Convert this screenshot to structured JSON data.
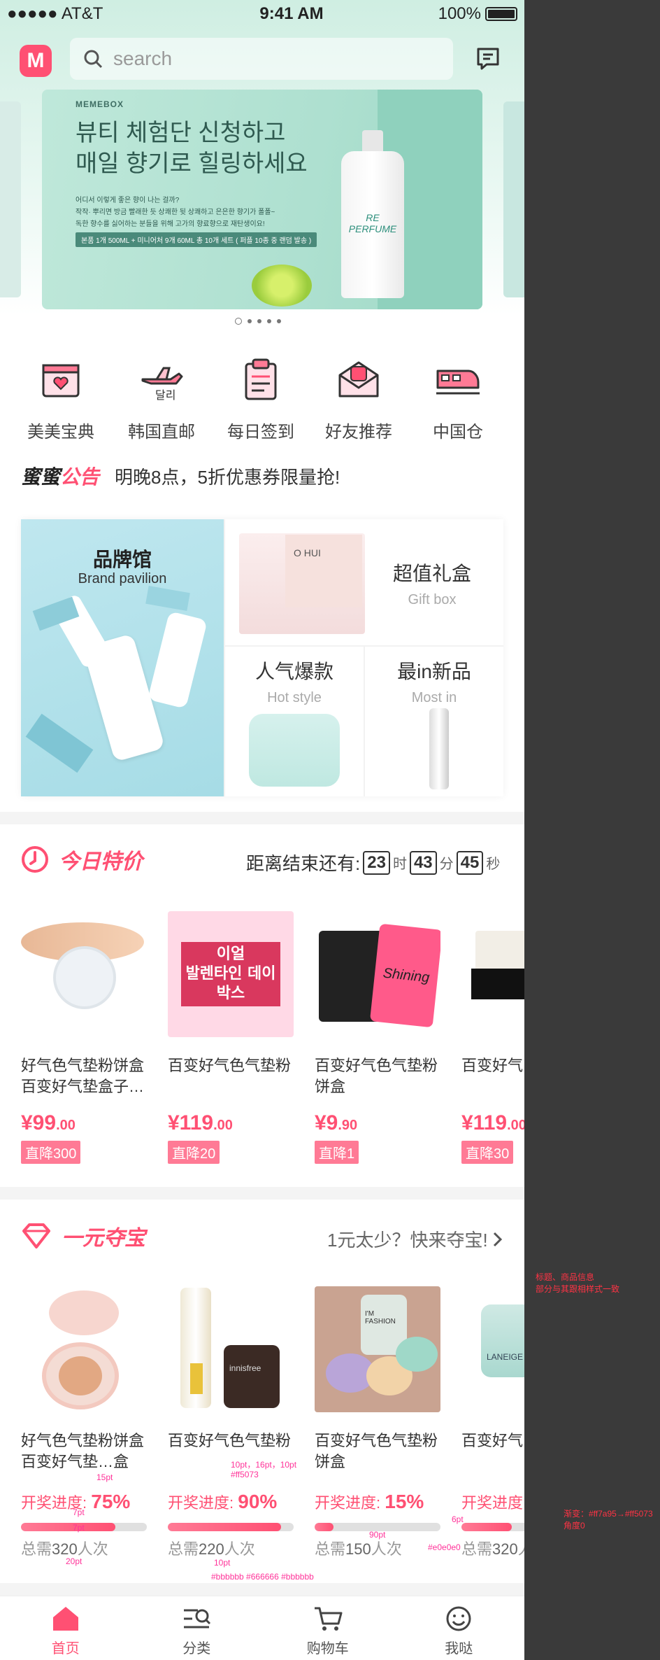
{
  "status_bar": {
    "carrier": "●●●●● AT&T",
    "time": "9:41 AM",
    "battery": "100%"
  },
  "header": {
    "logo": "M",
    "search_placeholder": "search"
  },
  "banner": {
    "brand": "MEMEBOX",
    "headline": "뷰티 체험단 신청하고\n매일 향기로 힐링하세요",
    "body": "어디서 이렇게 좋은 향이 나는 걸까?\n작작· 뿌리면 방금 빨래한 듯 상쾌한 뒷 상쾌하고 은은한 향기가 폴폴~\n독한 향수를 싫어하는 분들을 위해 고가의 향료향으로 재탄생이요!",
    "pill": "본품 1개 500ML + 미니어처 9개 60ML 총 10개 세트 ( 퍼플 10종 중 랜덤 발송 )",
    "bottle_label": "RE PERFUME",
    "page_count": 5,
    "active_page": 1
  },
  "categories": [
    {
      "label": "美美宝典",
      "icon": "book-heart-icon"
    },
    {
      "label": "韩国直邮",
      "icon": "airplane-icon"
    },
    {
      "label": "每日签到",
      "icon": "clipboard-icon"
    },
    {
      "label": "好友推荐",
      "icon": "envelope-icon"
    },
    {
      "label": "中国仓",
      "icon": "train-icon"
    }
  ],
  "notice": {
    "tag_a": "蜜蜜",
    "tag_b": "公告",
    "text": "明晚8点，5折优惠券限量抢!"
  },
  "brand_pavilion": {
    "title": "品牌馆",
    "subtitle": "Brand pavilion",
    "cells": [
      {
        "title": "超值礼盒",
        "subtitle": "Gift box"
      },
      {
        "title": "人气爆款",
        "subtitle": "Hot style"
      },
      {
        "title": "最in新品",
        "subtitle": "Most in"
      }
    ],
    "ohui": "O HUI"
  },
  "daily_deal": {
    "title": "今日特价",
    "countdown_label": "距离结束还有:",
    "hours": "23",
    "h_unit": "时",
    "minutes": "43",
    "m_unit": "分",
    "seconds": "45",
    "s_unit": "秒",
    "products": [
      {
        "name": "好气色气垫粉饼盒百变好气垫盒子…",
        "price_int": "¥99",
        "price_dec": ".00",
        "tag": "直降300"
      },
      {
        "name": "百变好气色气垫粉",
        "price_int": "¥119",
        "price_dec": ".00",
        "tag": "直降20"
      },
      {
        "name": "百变好气色气垫粉饼盒",
        "price_int": "¥9",
        "price_dec": ".90",
        "tag": "直降1"
      },
      {
        "name": "百变好气",
        "price_int": "¥119",
        "price_dec": ".00",
        "tag": "直降30"
      }
    ],
    "img_texts": {
      "p2": "이얼\n발렌타인 데이\n박스",
      "p3": "Shining"
    }
  },
  "treasure": {
    "title": "一元夺宝",
    "more": "1元太少？快来夺宝!",
    "progress_label": "开奖进度:",
    "need_prefix": "总需",
    "need_suffix": "人次",
    "items": [
      {
        "name": "好气色气垫粉饼盒百变好气垫…盒",
        "percent": "75%",
        "progress": 0.75,
        "count": "320"
      },
      {
        "name": "百变好气色气垫粉",
        "percent": "90%",
        "progress": 0.9,
        "count": "220"
      },
      {
        "name": "百变好气色气垫粉饼盒",
        "percent": "15%",
        "progress": 0.15,
        "count": "150"
      },
      {
        "name": "百变好气",
        "percent": "",
        "progress": 0.4,
        "count": "320"
      }
    ],
    "img_texts": {
      "innisfree": "innisfree",
      "laneige": "LANEIGE",
      "fashion": "I'M FASHION"
    }
  },
  "annotations": {
    "a1": "15pt",
    "a2": "10pt，16pt，10pt",
    "a3": "#ff5073",
    "a4": "7pt",
    "a5": "7pt",
    "a6": "20pt",
    "a7": "10pt",
    "a8": "#bbbbbb  #666666  #bbbbbb",
    "a9": "90pt",
    "a10": "6pt",
    "a11": "#e0e0e0",
    "right1": "标题、商品信息\n部分与其跟相样式一致",
    "right2": "渐变：#ff7a95→#ff5073\n角度0"
  },
  "tabbar": [
    {
      "label": "首页",
      "icon": "home-icon",
      "active": true
    },
    {
      "label": "分类",
      "icon": "category-icon",
      "active": false
    },
    {
      "label": "购物车",
      "icon": "cart-icon",
      "active": false
    },
    {
      "label": "我哒",
      "icon": "smiley-icon",
      "active": false
    }
  ],
  "colors": {
    "accent": "#ff5073",
    "gradient_start": "#ff7a95",
    "bar_bg": "#e0e0e0",
    "mint": "#cfeee2"
  }
}
